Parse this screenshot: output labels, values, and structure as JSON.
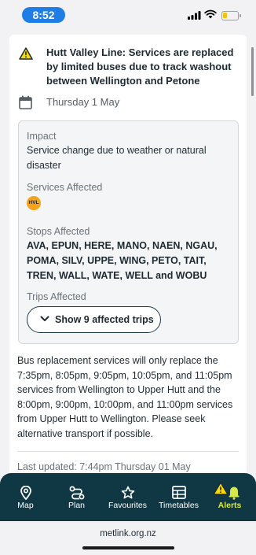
{
  "status_bar": {
    "time": "8:52"
  },
  "alert": {
    "title": "Hutt Valley Line: Services are replaced by limited buses due to track washout between Wellington and Petone",
    "date": "Thursday 1 May",
    "impact_label": "Impact",
    "impact_value": "Service change due to weather or natural disaster",
    "services_label": "Services Affected",
    "service_badge": "HVL",
    "stops_label": "Stops Affected",
    "stops_value": "AVA, EPUN, HERE, MANO, NAEN, NGAU, POMA, SILV, UPPE, WING, PETO, TAIT, TREN, WALL, WATE, WELL and WOBU",
    "trips_label": "Trips Affected",
    "trips_button": "Show 9 affected trips",
    "description": "Bus replacement services will only replace the 7:35pm, 8:05pm, 9:05pm, 10:05pm, and 11:05pm services from Wellington to Upper Hutt and the 8:00pm, 9:00pm, 10:00pm, and 11:00pm services from Upper Hutt to Wellington. Please seek alternative transport if possible.",
    "last_updated": "Last updated: 7:44pm Thursday 01 May"
  },
  "tabs": [
    {
      "label": "Map",
      "icon": "map-pin-icon"
    },
    {
      "label": "Plan",
      "icon": "route-icon"
    },
    {
      "label": "Favourites",
      "icon": "star-icon"
    },
    {
      "label": "Timetables",
      "icon": "timetable-icon"
    },
    {
      "label": "Alerts",
      "icon": "alert-bell-icon",
      "active": true
    }
  ],
  "browser": {
    "url": "metlink.org.nz"
  },
  "colors": {
    "nav_bg": "#0f3844",
    "active_tab": "#d6e84a",
    "warning": "#f5d90a",
    "hvl": "#f6a21c",
    "time_pill": "#1f7de6"
  }
}
